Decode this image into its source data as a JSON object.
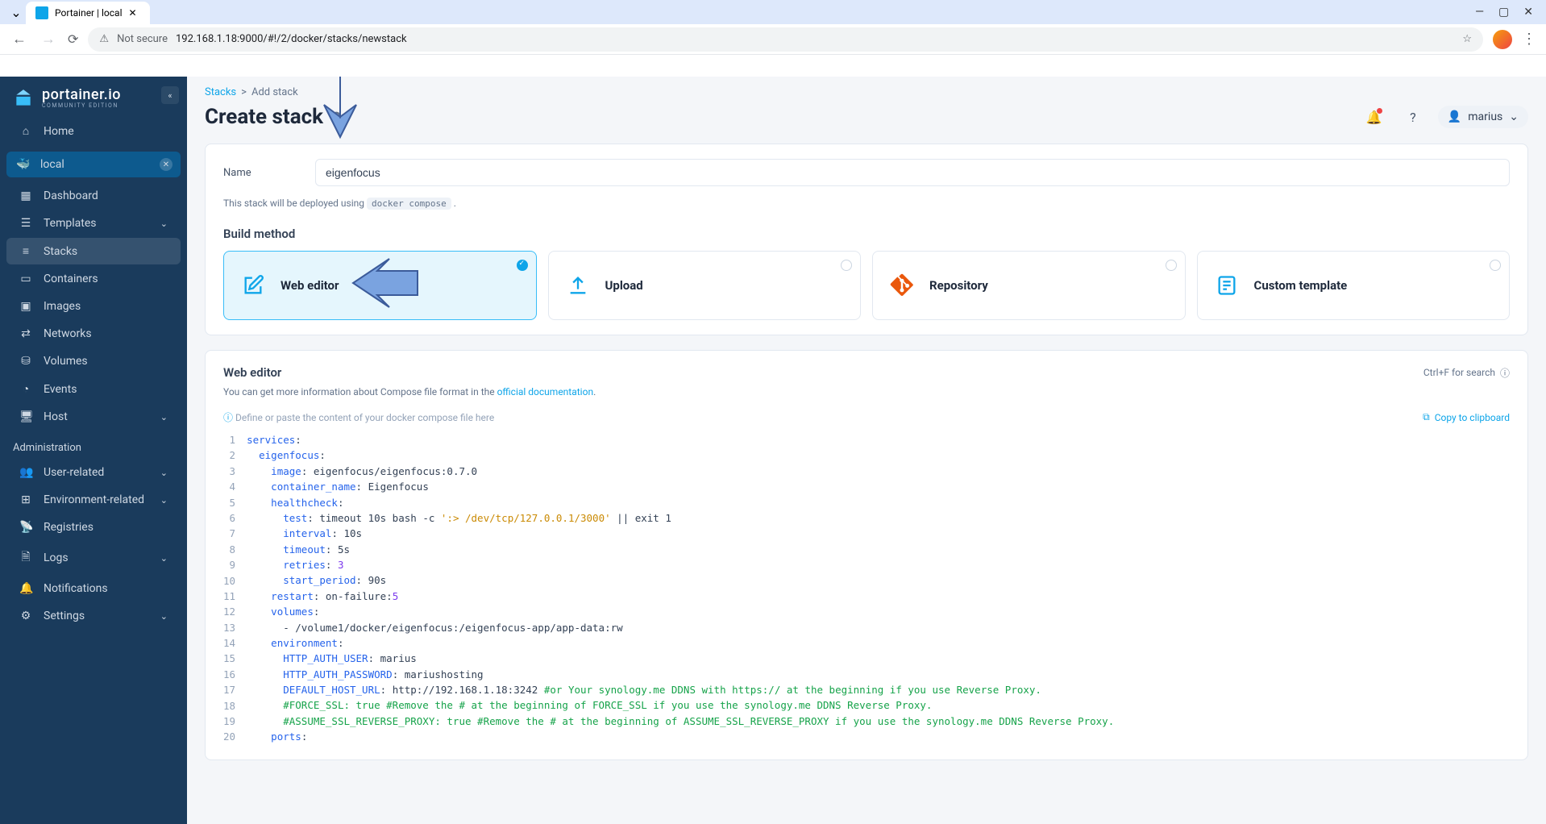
{
  "browser": {
    "tab_title": "Portainer | local",
    "not_secure": "Not secure",
    "url": "192.168.1.18:9000/#!/2/docker/stacks/newstack"
  },
  "sidebar": {
    "brand": "portainer.io",
    "edition": "COMMUNITY EDITION",
    "home": "Home",
    "env": "local",
    "items": [
      "Dashboard",
      "Templates",
      "Stacks",
      "Containers",
      "Images",
      "Networks",
      "Volumes",
      "Events",
      "Host"
    ],
    "admin_label": "Administration",
    "admin_items": [
      "User-related",
      "Environment-related",
      "Registries",
      "Logs",
      "Notifications",
      "Settings"
    ]
  },
  "header": {
    "breadcrumb_root": "Stacks",
    "breadcrumb_current": "Add stack",
    "title": "Create stack",
    "user": "marius"
  },
  "form": {
    "name_label": "Name",
    "name_value": "eigenfocus",
    "hint_pre": "This stack will be deployed using ",
    "hint_code": "docker compose",
    "build_method_label": "Build method",
    "methods": [
      "Web editor",
      "Upload",
      "Repository",
      "Custom template"
    ]
  },
  "editor": {
    "title": "Web editor",
    "search_hint": "Ctrl+F for search",
    "desc_pre": "You can get more information about Compose file format in the ",
    "desc_link": "official documentation",
    "placeholder": "Define or paste the content of your docker compose file here",
    "copy": "Copy to clipboard",
    "lines": [
      {
        "n": 1,
        "html": "<span class='key'>services</span>:"
      },
      {
        "n": 2,
        "html": "  <span class='key'>eigenfocus</span>:"
      },
      {
        "n": 3,
        "html": "    <span class='key'>image</span>: eigenfocus/eigenfocus:0.7.0"
      },
      {
        "n": 4,
        "html": "    <span class='key'>container_name</span>: Eigenfocus"
      },
      {
        "n": 5,
        "html": "    <span class='key'>healthcheck</span>:"
      },
      {
        "n": 6,
        "html": "      <span class='key'>test</span>: timeout 10s bash -c <span class='str'>':&gt; /dev/tcp/127.0.0.1/3000'</span> || exit 1"
      },
      {
        "n": 7,
        "html": "      <span class='key'>interval</span>: 10s"
      },
      {
        "n": 8,
        "html": "      <span class='key'>timeout</span>: 5s"
      },
      {
        "n": 9,
        "html": "      <span class='key'>retries</span>: <span class='num'>3</span>"
      },
      {
        "n": 10,
        "html": "      <span class='key'>start_period</span>: 90s"
      },
      {
        "n": 11,
        "html": "    <span class='key'>restart</span>: on-failure:<span class='num'>5</span>"
      },
      {
        "n": 12,
        "html": "    <span class='key'>volumes</span>:"
      },
      {
        "n": 13,
        "html": "      - /volume1/docker/eigenfocus:/eigenfocus-app/app-data:rw"
      },
      {
        "n": 14,
        "html": "    <span class='key'>environment</span>:"
      },
      {
        "n": 15,
        "html": "      <span class='key'>HTTP_AUTH_USER</span>: marius"
      },
      {
        "n": 16,
        "html": "      <span class='key'>HTTP_AUTH_PASSWORD</span>: mariushosting"
      },
      {
        "n": 17,
        "html": "      <span class='key'>DEFAULT_HOST_URL</span>: http://192.168.1.18:3242 <span class='comment'>#or Your synology.me DDNS with https:// at the beginning if you use Reverse Proxy.</span>"
      },
      {
        "n": 18,
        "html": "      <span class='comment'>#FORCE_SSL: true #Remove the # at the beginning of FORCE_SSL if you use the synology.me DDNS Reverse Proxy.</span>"
      },
      {
        "n": 19,
        "html": "      <span class='comment'>#ASSUME_SSL_REVERSE_PROXY: true #Remove the # at the beginning of ASSUME_SSL_REVERSE_PROXY if you use the synology.me DDNS Reverse Proxy.</span>"
      },
      {
        "n": 20,
        "html": "    <span class='key'>ports</span>:"
      }
    ]
  }
}
